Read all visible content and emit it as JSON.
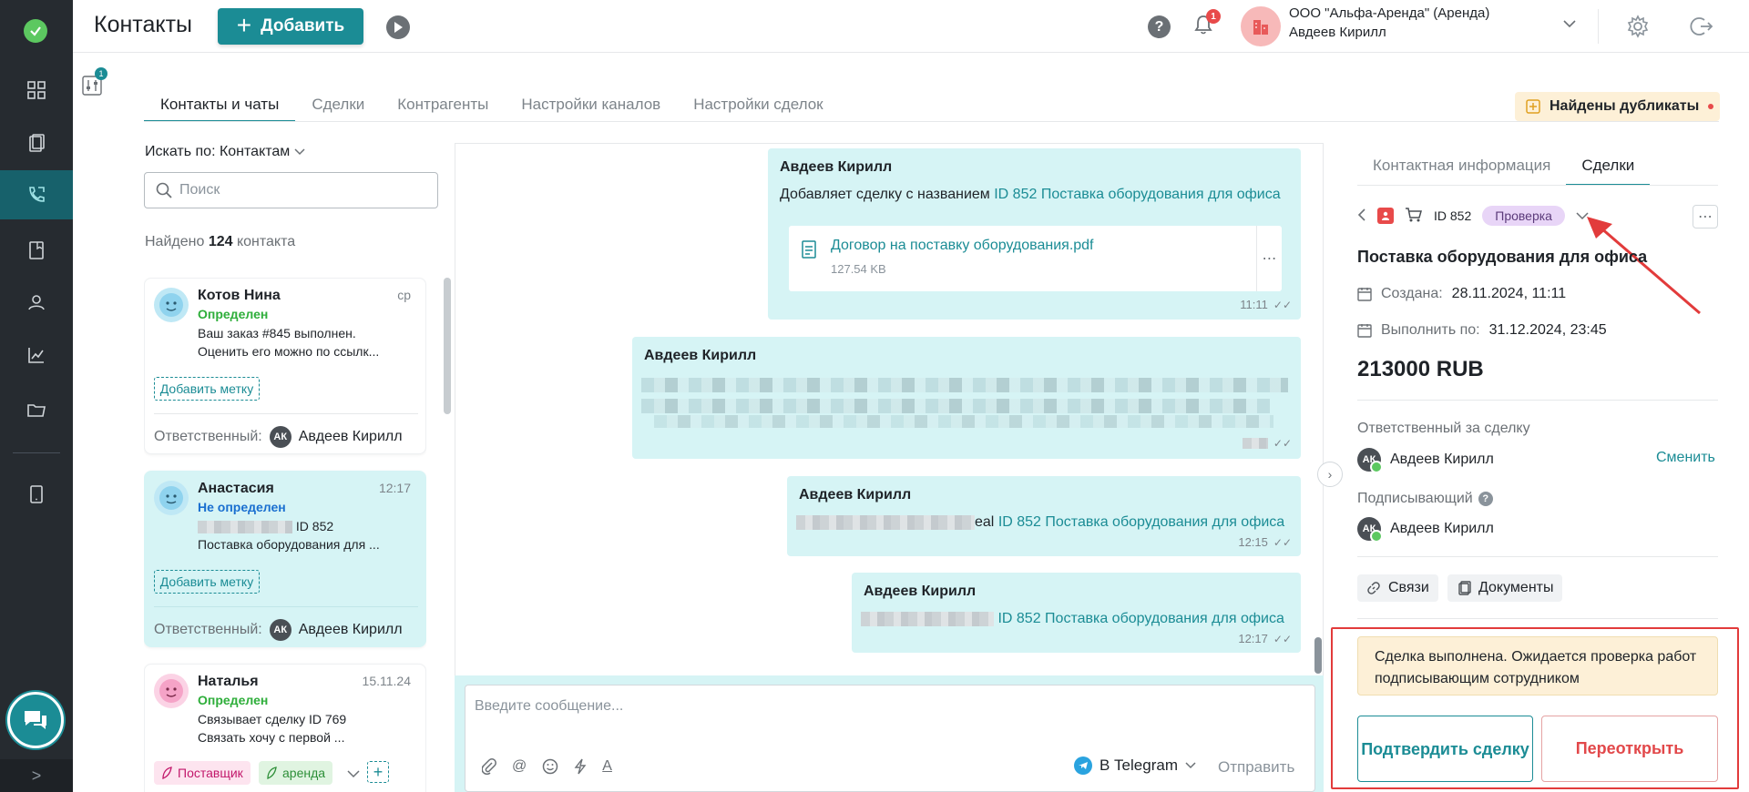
{
  "header": {
    "title": "Контакты",
    "add_label": "Добавить",
    "notifications_count": "1",
    "org_name": "ООО \"Альфа-Аренда\" (Аренда)",
    "user_name": "Авдеев Кирилл"
  },
  "filter_badge": "1",
  "tabs": [
    {
      "label": "Контакты и чаты",
      "active": true
    },
    {
      "label": "Сделки",
      "active": false
    },
    {
      "label": "Контрагенты",
      "active": false
    },
    {
      "label": "Настройки каналов",
      "active": false
    },
    {
      "label": "Настройки сделок",
      "active": false
    }
  ],
  "duplicates_label": "Найдены дубликаты",
  "contacts": {
    "search_by": "Искать по: Контактам",
    "search_placeholder": "Поиск",
    "found_prefix": "Найдено",
    "found_count": "124",
    "found_suffix": "контакта",
    "add_tag_label": "Добавить метку",
    "responsible_label": "Ответственный:",
    "items": [
      {
        "name": "Котов Нина",
        "time": "ср",
        "status": "Определен",
        "msg1": "Ваш заказ #845 выполнен.",
        "msg2": "Оценить его можно по ссылк...",
        "responsible": "Авдеев Кирилл",
        "initials": "АК"
      },
      {
        "name": "Анастасия",
        "time": "12:17",
        "status": "Не определен",
        "msg1": "ID 852",
        "msg2": "Поставка оборудования для ...",
        "responsible": "Авдеев Кирилл",
        "initials": "АК"
      },
      {
        "name": "Наталья",
        "time": "15.11.24",
        "status": "Определен",
        "msg1": "Связывает сделку ID 769",
        "msg2": "Связать хочу с первой ...",
        "tags": [
          "Поставщик",
          "аренда"
        ]
      }
    ]
  },
  "chat": {
    "messages": [
      {
        "author": "Авдеев Кирилл",
        "text": "Добавляет сделку с названием",
        "link": "ID 852 Поставка оборудования для офиса",
        "file_name": "Договор на поставку оборудования.pdf",
        "file_size": "127.54 KB",
        "time": "11:11"
      },
      {
        "author": "Авдеев Кирилл",
        "time": ""
      },
      {
        "author": "Авдеев Кирилл",
        "text": "eal",
        "link": "ID 852 Поставка оборудования для офиса",
        "time": "12:15"
      },
      {
        "author": "Авдеев Кирилл",
        "link": "ID 852 Поставка оборудования для офиса",
        "time": "12:17"
      }
    ],
    "composer_placeholder": "Введите сообщение...",
    "channel": "В Telegram",
    "send_label": "Отправить"
  },
  "details": {
    "tabs": [
      {
        "label": "Контактная информация",
        "active": false
      },
      {
        "label": "Сделки",
        "active": true
      }
    ],
    "deal_id": "ID 852",
    "status": "Проверка",
    "title": "Поставка оборудования для офиса",
    "created_label": "Создана:",
    "created_value": "28.11.2024, 11:11",
    "due_label": "Выполнить по:",
    "due_value": "31.12.2024, 23:45",
    "amount": "213000 RUB",
    "responsible_label": "Ответственный за сделку",
    "responsible_name": "Авдеев Кирилл",
    "change_label": "Сменить",
    "signer_label": "Подписывающий",
    "signer_name": "Авдеев Кирилл",
    "initials": "АК",
    "links_label": "Связи",
    "docs_label": "Документы",
    "notice": "Сделка выполнена. Ожидается проверка работ подписывающим сотрудником",
    "confirm_label": "Подтвердить сделку",
    "reopen_label": "Переоткрыть"
  },
  "colors": {
    "accent": "#1b8c95",
    "status": "#e8d5f7",
    "highlight": "#e23b3b"
  }
}
